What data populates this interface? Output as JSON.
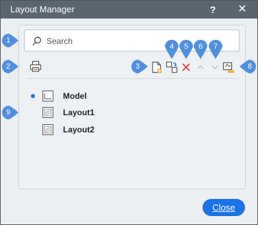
{
  "window": {
    "title": "Layout Manager",
    "help_label": "?",
    "close_glyph": "✕"
  },
  "search": {
    "placeholder": "Search",
    "value": ""
  },
  "toolbar": {
    "print_icon": "printer-icon",
    "new_layout_icon": "new-layout-icon",
    "copy_layout_icon": "copy-layout-icon",
    "delete_icon": "delete-icon",
    "move_up_icon": "chevron-up-icon",
    "move_down_icon": "chevron-down-icon",
    "page_setup_icon": "page-setup-icon",
    "delete_color": "#e03a3a",
    "disabled_color": "#b8bfc6"
  },
  "layouts": [
    {
      "label": "Model",
      "current": true
    },
    {
      "label": "Layout1",
      "current": false
    },
    {
      "label": "Layout2",
      "current": false
    }
  ],
  "footer": {
    "close_label": "Close"
  },
  "callouts": [
    "1",
    "2",
    "3",
    "4",
    "5",
    "6",
    "7",
    "8",
    "9"
  ],
  "colors": {
    "titlebar": "#5a6570",
    "accent": "#1a73e8",
    "callout": "#4f8fe0"
  }
}
